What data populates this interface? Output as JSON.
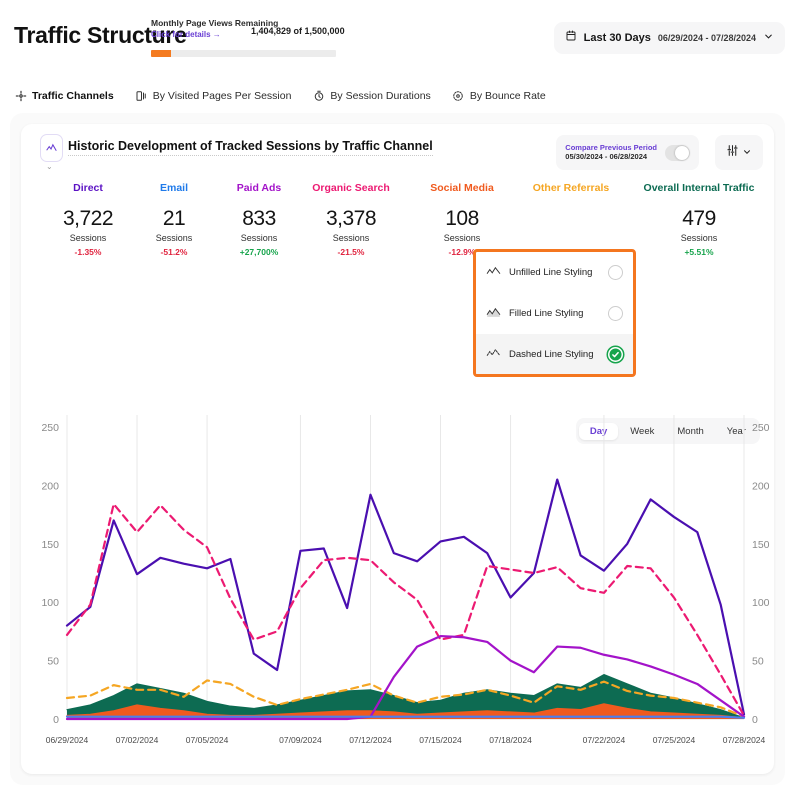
{
  "header": {
    "title": "Traffic Structure",
    "quota_label": "Monthly Page Views Remaining",
    "quota_link": "Click for details →",
    "quota_count": "1,404,829 of 1,500,000",
    "quota_percent": 6,
    "refresh_icon": "refresh-icon",
    "date_picker": {
      "icon": "calendar-icon",
      "label": "Last 30 Days",
      "range": "06/29/2024 - 07/28/2024",
      "chevron": "chevron-down-icon"
    }
  },
  "tabs": [
    {
      "label": "Traffic Channels",
      "icon": "traffic-channels-icon",
      "active": true
    },
    {
      "label": "By Visited Pages Per Session",
      "icon": "pages-icon",
      "active": false
    },
    {
      "label": "By Session Durations",
      "icon": "clock-icon",
      "active": false
    },
    {
      "label": "By Bounce Rate",
      "icon": "bounce-icon",
      "active": false
    }
  ],
  "card": {
    "icon": "chart-card-icon",
    "title": "Historic Development of Tracked Sessions by Traffic Channel",
    "compare": {
      "title": "Compare Previous Period",
      "range": "05/30/2024 - 06/28/2024",
      "toggle_on": false
    },
    "settings_icon": "sliders-icon",
    "settings_chevron": "chevron-down-icon"
  },
  "kpis": [
    {
      "label": "Direct",
      "value": "3,722",
      "unit": "Sessions",
      "delta": "-1.35%",
      "color": "#5b12c4",
      "delta_color": "#e0243f"
    },
    {
      "label": "Email",
      "value": "21",
      "unit": "Sessions",
      "delta": "-51.2%",
      "color": "#1f7aea",
      "delta_color": "#e0243f"
    },
    {
      "label": "Paid Ads",
      "value": "833",
      "unit": "Sessions",
      "delta": "+27,700%",
      "color": "#a313c9",
      "delta_color": "#17a44c"
    },
    {
      "label": "Organic Search",
      "value": "3,378",
      "unit": "Sessions",
      "delta": "-21.5%",
      "color": "#ec1a72",
      "delta_color": "#e0243f"
    },
    {
      "label": "Social Media",
      "value": "108",
      "unit": "Sessions",
      "delta": "-12.9%",
      "color": "#f05a1e",
      "delta_color": "#e0243f"
    },
    {
      "label": "Other Referrals",
      "value": "",
      "unit": "",
      "delta": "",
      "color": "#f5a623",
      "delta_color": "#e0243f"
    },
    {
      "label": "Overall Internal Traffic",
      "value": "479",
      "unit": "Sessions",
      "delta": "+5.51%",
      "color": "#0c6b52",
      "delta_color": "#17a44c"
    }
  ],
  "dropdown": {
    "items": [
      {
        "label": "Unfilled Line Styling",
        "icon": "unfilled-line-icon",
        "selected": false,
        "highlighted": false
      },
      {
        "label": "Filled Line Styling",
        "icon": "filled-line-icon",
        "selected": false,
        "highlighted": false
      },
      {
        "label": "Dashed Line Styling",
        "icon": "dashed-line-icon",
        "selected": true,
        "highlighted": true
      }
    ]
  },
  "granularity": {
    "options": [
      "Day",
      "Week",
      "Month",
      "Year"
    ],
    "selected": "Day"
  },
  "chart_data": {
    "type": "line",
    "title": "Historic Development of Tracked Sessions by Traffic Channel",
    "xlabel": "",
    "ylabel": "",
    "ylim": [
      0,
      250
    ],
    "yticks": [
      0,
      50,
      100,
      150,
      200,
      250
    ],
    "grid": true,
    "legend_position": "top",
    "dual_axis": true,
    "x": [
      "06/29/2024",
      "06/30/2024",
      "07/01/2024",
      "07/02/2024",
      "07/03/2024",
      "07/04/2024",
      "07/05/2024",
      "07/06/2024",
      "07/07/2024",
      "07/08/2024",
      "07/09/2024",
      "07/10/2024",
      "07/11/2024",
      "07/12/2024",
      "07/13/2024",
      "07/14/2024",
      "07/15/2024",
      "07/16/2024",
      "07/17/2024",
      "07/18/2024",
      "07/19/2024",
      "07/20/2024",
      "07/21/2024",
      "07/22/2024",
      "07/23/2024",
      "07/24/2024",
      "07/25/2024",
      "07/26/2024",
      "07/27/2024",
      "07/28/2024"
    ],
    "xticks": [
      "06/29/2024",
      "07/02/2024",
      "07/05/2024",
      "07/09/2024",
      "07/12/2024",
      "07/15/2024",
      "07/18/2024",
      "07/22/2024",
      "07/25/2024",
      "07/28/2024"
    ],
    "series": [
      {
        "name": "Direct",
        "color": "#4a0fb0",
        "style": "solid",
        "fill": false,
        "values": [
          80,
          96,
          170,
          124,
          138,
          133,
          129,
          137,
          56,
          42,
          144,
          146,
          95,
          192,
          142,
          135,
          152,
          156,
          142,
          104,
          125,
          205,
          140,
          127,
          150,
          188,
          173,
          160,
          98,
          4
        ]
      },
      {
        "name": "Organic Search",
        "color": "#ec1a72",
        "style": "dashed",
        "fill": false,
        "values": [
          72,
          98,
          184,
          160,
          183,
          162,
          147,
          103,
          68,
          75,
          112,
          136,
          138,
          136,
          117,
          102,
          68,
          72,
          131,
          128,
          125,
          130,
          112,
          108,
          131,
          129,
          104,
          72,
          38,
          3
        ]
      },
      {
        "name": "Other Referrals",
        "color": "#f5a623",
        "style": "dashed",
        "fill": false,
        "values": [
          18,
          20,
          29,
          25,
          25,
          19,
          33,
          30,
          19,
          12,
          17,
          21,
          25,
          30,
          20,
          14,
          19,
          21,
          25,
          20,
          14,
          28,
          25,
          32,
          24,
          20,
          18,
          14,
          10,
          2
        ]
      },
      {
        "name": "Social Media",
        "color": "#0d6b52",
        "style": "solid",
        "fill": true,
        "values": [
          8,
          12,
          20,
          30,
          26,
          22,
          15,
          11,
          9,
          12,
          16,
          20,
          24,
          25,
          20,
          14,
          16,
          22,
          25,
          22,
          20,
          30,
          27,
          38,
          30,
          22,
          18,
          13,
          8,
          1
        ]
      },
      {
        "name": "Paid Ads",
        "color": "#a313c9",
        "style": "solid",
        "fill": false,
        "values": [
          0,
          0,
          0,
          0,
          0,
          0,
          0,
          0,
          0,
          0,
          0,
          0,
          0,
          2,
          36,
          62,
          71,
          70,
          66,
          50,
          40,
          62,
          61,
          55,
          51,
          45,
          38,
          30,
          16,
          2
        ]
      },
      {
        "name": "Email",
        "color": "#f05a1e",
        "style": "solid",
        "fill": true,
        "values": [
          3,
          4,
          7,
          12,
          9,
          7,
          4,
          3,
          3,
          4,
          5,
          6,
          7,
          7,
          6,
          4,
          5,
          6,
          7,
          6,
          5,
          9,
          8,
          13,
          9,
          6,
          5,
          4,
          3,
          1
        ]
      },
      {
        "name": "Internal",
        "color": "#4a7ef0",
        "style": "solid",
        "fill": false,
        "values": [
          2,
          2,
          2,
          2,
          2,
          2,
          2,
          2,
          2,
          2,
          2,
          2,
          2,
          2,
          2,
          2,
          2,
          2,
          2,
          2,
          2,
          2,
          2,
          2,
          2,
          2,
          2,
          2,
          2,
          1
        ]
      }
    ]
  }
}
